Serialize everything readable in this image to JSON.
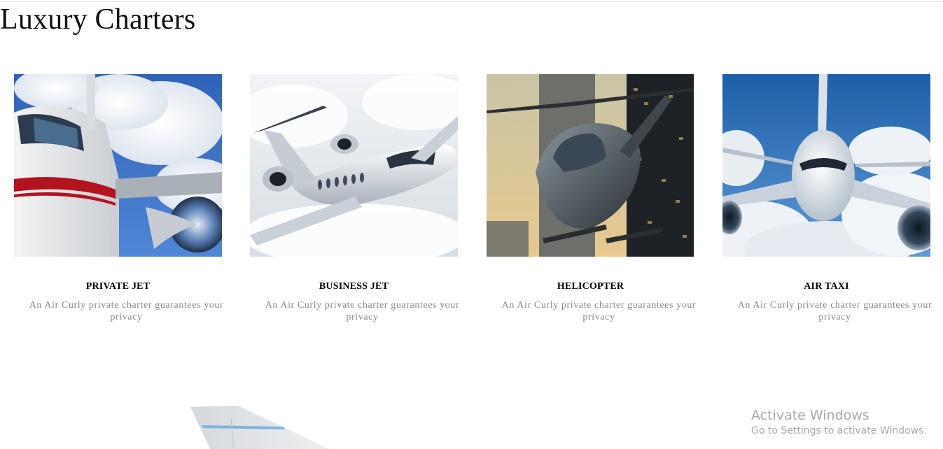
{
  "page": {
    "title": "Luxury Charters"
  },
  "cards": [
    {
      "title": "PRIVATE JET",
      "description": "An Air Curly private charter guarantees your privacy",
      "image": "private-jet-photo"
    },
    {
      "title": "BUSINESS JET",
      "description": "An Air Curly private charter guarantees your privacy",
      "image": "business-jet-photo"
    },
    {
      "title": "HELICOPTER",
      "description": "An Air Curly private charter guarantees your privacy",
      "image": "helicopter-photo"
    },
    {
      "title": "AIR TAXI",
      "description": "An Air Curly private charter guarantees your privacy",
      "image": "air-taxi-photo"
    }
  ],
  "watermark": {
    "title": "Activate Windows",
    "subtitle": "Go to Settings to activate Windows."
  },
  "colors": {
    "title_text": "#111111",
    "card_title": "#000000",
    "card_description": "#8a8a8a",
    "watermark": "#a8a8a8"
  }
}
